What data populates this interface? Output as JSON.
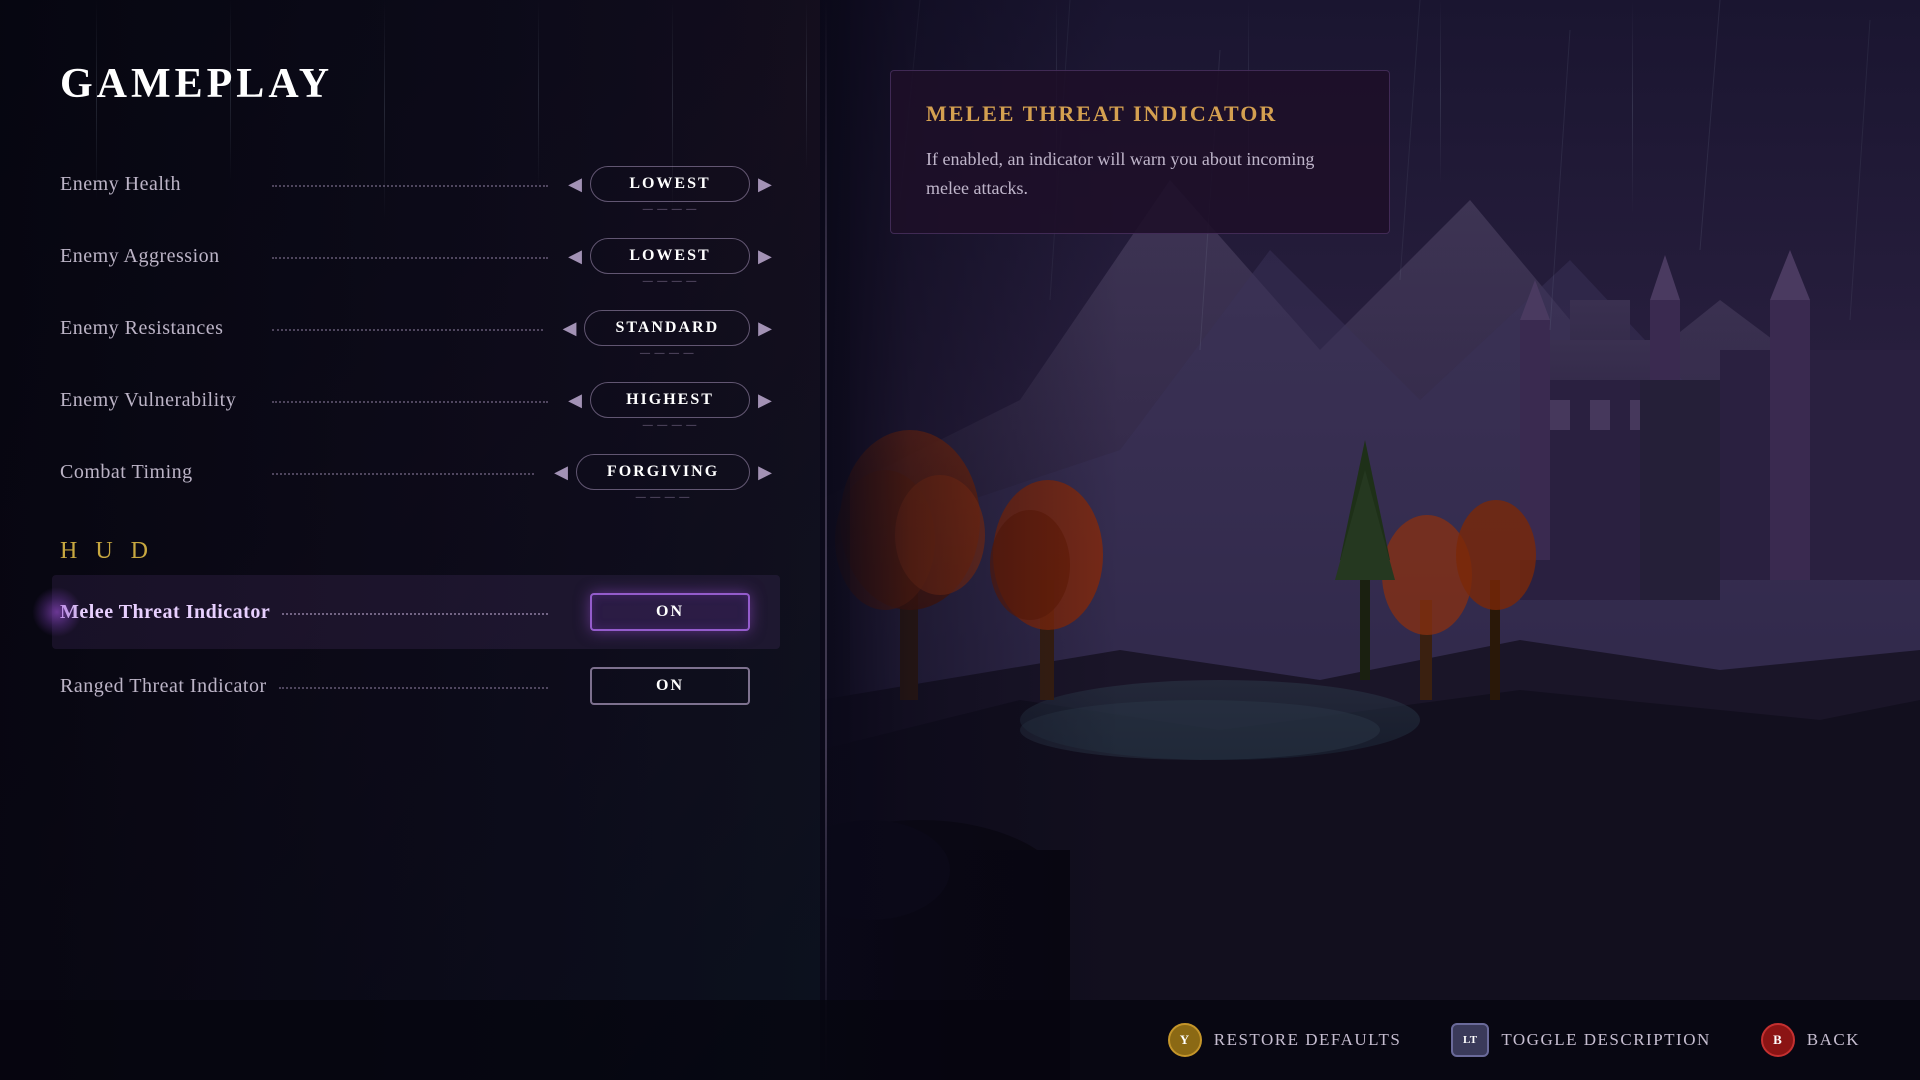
{
  "page": {
    "title": "GAMEPLAY"
  },
  "settings": {
    "combat_section": [
      {
        "id": "enemy-health",
        "label": "Enemy Health",
        "value": "LOWEST",
        "type": "selector"
      },
      {
        "id": "enemy-aggression",
        "label": "Enemy Aggression",
        "value": "LOWEST",
        "type": "selector"
      },
      {
        "id": "enemy-resistances",
        "label": "Enemy Resistances",
        "value": "STANDARD",
        "type": "selector"
      },
      {
        "id": "enemy-vulnerability",
        "label": "Enemy Vulnerability",
        "value": "HIGHEST",
        "type": "selector"
      },
      {
        "id": "combat-timing",
        "label": "Combat Timing",
        "value": "FORGIVING",
        "type": "selector"
      }
    ],
    "hud_section_label": "H U D",
    "hud_section": [
      {
        "id": "melee-threat",
        "label": "Melee Threat Indicator",
        "value": "ON",
        "type": "toggle",
        "active": true
      },
      {
        "id": "ranged-threat",
        "label": "Ranged Threat Indicator",
        "value": "ON",
        "type": "toggle",
        "active": false
      }
    ]
  },
  "description": {
    "title": "MELEE THREAT INDICATOR",
    "text": "If enabled, an indicator will warn you about incoming melee attacks."
  },
  "bottom_bar": {
    "actions": [
      {
        "id": "restore-defaults",
        "btn_label": "Y",
        "btn_type": "y",
        "label": "RESTORE DEFAULTS"
      },
      {
        "id": "toggle-description",
        "btn_label": "LT",
        "btn_type": "lt",
        "label": "TOGGLE DESCRIPTION"
      },
      {
        "id": "back",
        "btn_label": "B",
        "btn_type": "b",
        "label": "BACK"
      }
    ]
  },
  "icons": {
    "arrow_left": "◀",
    "arrow_right": "▶"
  }
}
